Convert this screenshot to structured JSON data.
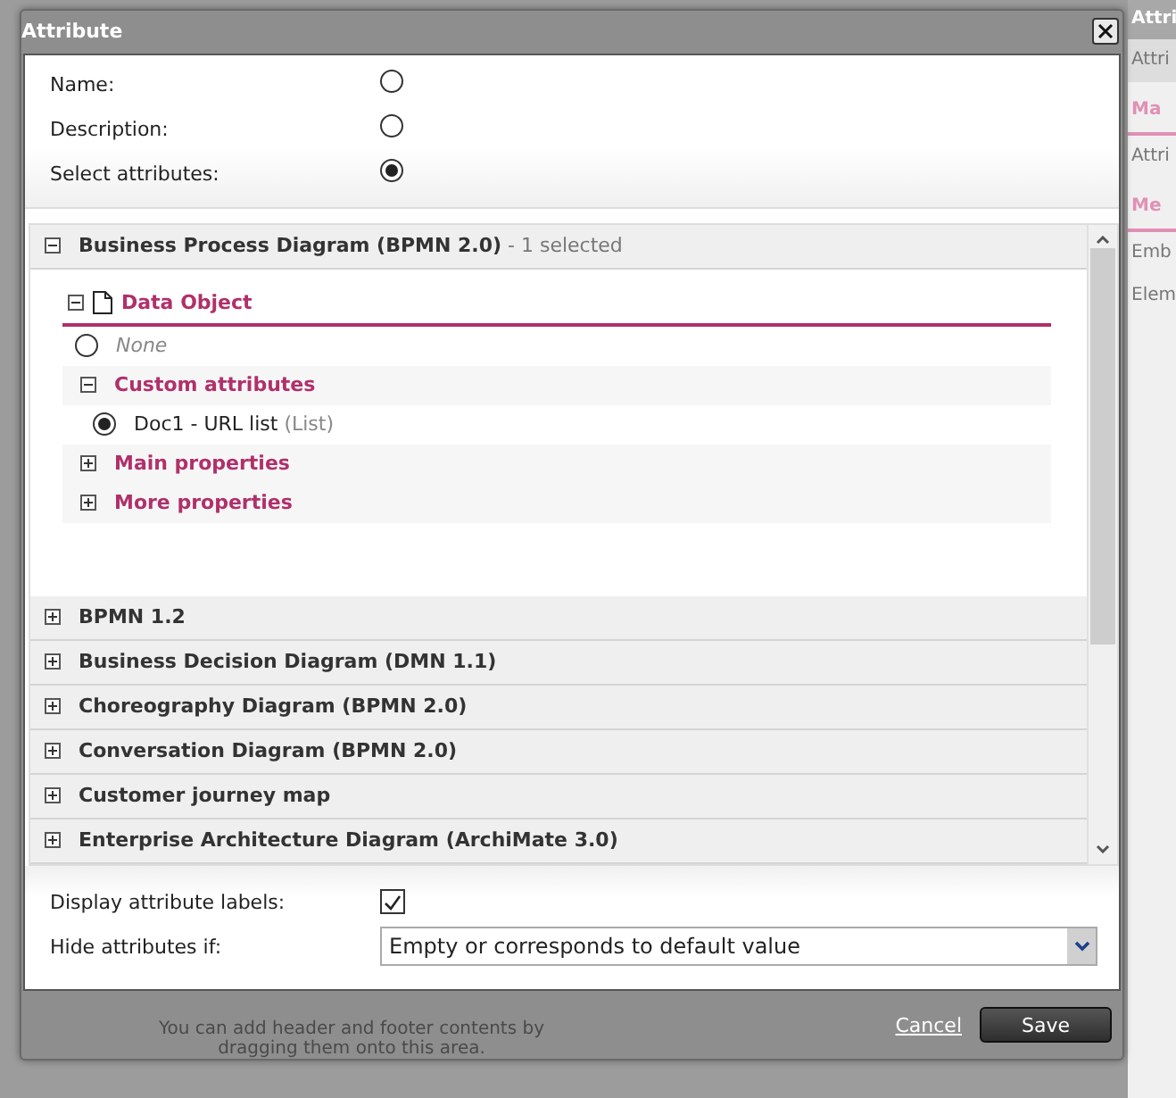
{
  "dialog": {
    "title": "Attribute"
  },
  "options": [
    {
      "label": "Name:",
      "selected": false
    },
    {
      "label": "Description:",
      "selected": false
    },
    {
      "label": "Select attributes:",
      "selected": true
    }
  ],
  "groups": [
    {
      "label": "Business Process Diagram (BPMN 2.0)",
      "suffix": "- 1 selected",
      "expanded": true,
      "object": {
        "label": "Data Object",
        "expanded": true,
        "none": {
          "label": "None",
          "selected": false
        },
        "sections": [
          {
            "label": "Custom attributes",
            "expanded": true,
            "items": [
              {
                "label": "Doc1 - URL list",
                "type": "(List)",
                "selected": true
              }
            ]
          },
          {
            "label": "Main properties",
            "expanded": false
          },
          {
            "label": "More properties",
            "expanded": false
          }
        ]
      }
    },
    {
      "label": "BPMN 1.2",
      "expanded": false
    },
    {
      "label": "Business Decision Diagram (DMN 1.1)",
      "expanded": false
    },
    {
      "label": "Choreography Diagram (BPMN 2.0)",
      "expanded": false
    },
    {
      "label": "Conversation Diagram (BPMN 2.0)",
      "expanded": false
    },
    {
      "label": "Customer journey map",
      "expanded": false
    },
    {
      "label": "Enterprise Architecture Diagram (ArchiMate 3.0)",
      "expanded": false
    }
  ],
  "display_labels": {
    "label": "Display attribute labels:",
    "checked": true
  },
  "hide_if": {
    "label": "Hide attributes if:",
    "value": "Empty or corresponds to default value"
  },
  "buttons": {
    "cancel": "Cancel",
    "save": "Save"
  },
  "background": {
    "hint": "You can add header and footer contents by dragging them onto this area.",
    "side_panel": [
      {
        "text": "Attri",
        "kind": "title"
      },
      {
        "text": "Attri",
        "kind": "tab"
      },
      {
        "text": "Ma",
        "kind": "heading"
      },
      {
        "text": "Attri",
        "kind": "text"
      },
      {
        "text": "Me",
        "kind": "heading"
      },
      {
        "text": "Emb",
        "kind": "text"
      },
      {
        "text": "Elem",
        "kind": "text"
      }
    ]
  }
}
